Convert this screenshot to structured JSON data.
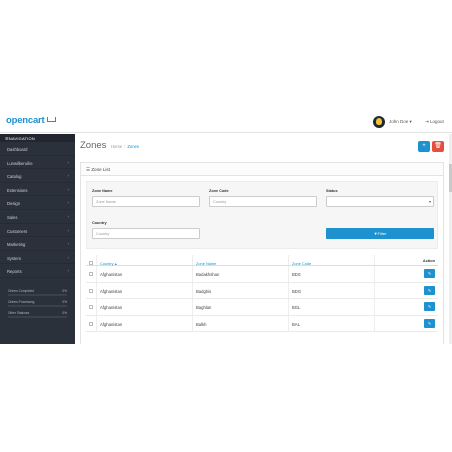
{
  "header": {
    "logo_text": "opencart",
    "user_name": "John Doe",
    "logout_label": "Logout"
  },
  "sidebar": {
    "nav_title": "NAVIGATION",
    "items": [
      {
        "label": "Dashboard",
        "has_children": false
      },
      {
        "label": "Lunwilkeruihe",
        "has_children": true
      },
      {
        "label": "Catalog",
        "has_children": true
      },
      {
        "label": "Extensions",
        "has_children": true
      },
      {
        "label": "Design",
        "has_children": true
      },
      {
        "label": "Sales",
        "has_children": true
      },
      {
        "label": "Customers",
        "has_children": true
      },
      {
        "label": "Marketing",
        "has_children": true
      },
      {
        "label": "System",
        "has_children": true
      },
      {
        "label": "Reports",
        "has_children": true
      }
    ],
    "progress": [
      {
        "label": "Orders Completed",
        "value": "0%",
        "fraction": 0
      },
      {
        "label": "Orders Processing",
        "value": "0%",
        "fraction": 0
      },
      {
        "label": "Other Statuses",
        "value": "0%",
        "fraction": 0
      }
    ]
  },
  "page": {
    "title": "Zones",
    "breadcrumb": [
      "Home",
      "Zones"
    ]
  },
  "panel": {
    "heading": "Zone List"
  },
  "filter": {
    "zone_name_label": "Zone Name",
    "zone_name_placeholder": "Zone Name",
    "zone_code_label": "Zone Code",
    "zone_code_placeholder": "Country",
    "status_label": "Status",
    "status_value": "",
    "country_label": "Country",
    "country_placeholder": "Country",
    "filter_button": "Filter"
  },
  "table": {
    "columns": [
      "Country",
      "Zone Name",
      "Zone Code",
      "Action"
    ],
    "rows": [
      {
        "country": "Afghanistan",
        "zone_name": "Badakhshan",
        "zone_code": "BDS"
      },
      {
        "country": "Afghanistan",
        "zone_name": "Badghis",
        "zone_code": "BDG"
      },
      {
        "country": "Afghanistan",
        "zone_name": "Baghlan",
        "zone_code": "BGL"
      },
      {
        "country": "Afghanistan",
        "zone_name": "Balkh",
        "zone_code": "BAL"
      }
    ]
  },
  "colors": {
    "primary": "#1e91cf",
    "danger": "#e3503e",
    "sidebar_bg": "#2b313b"
  }
}
